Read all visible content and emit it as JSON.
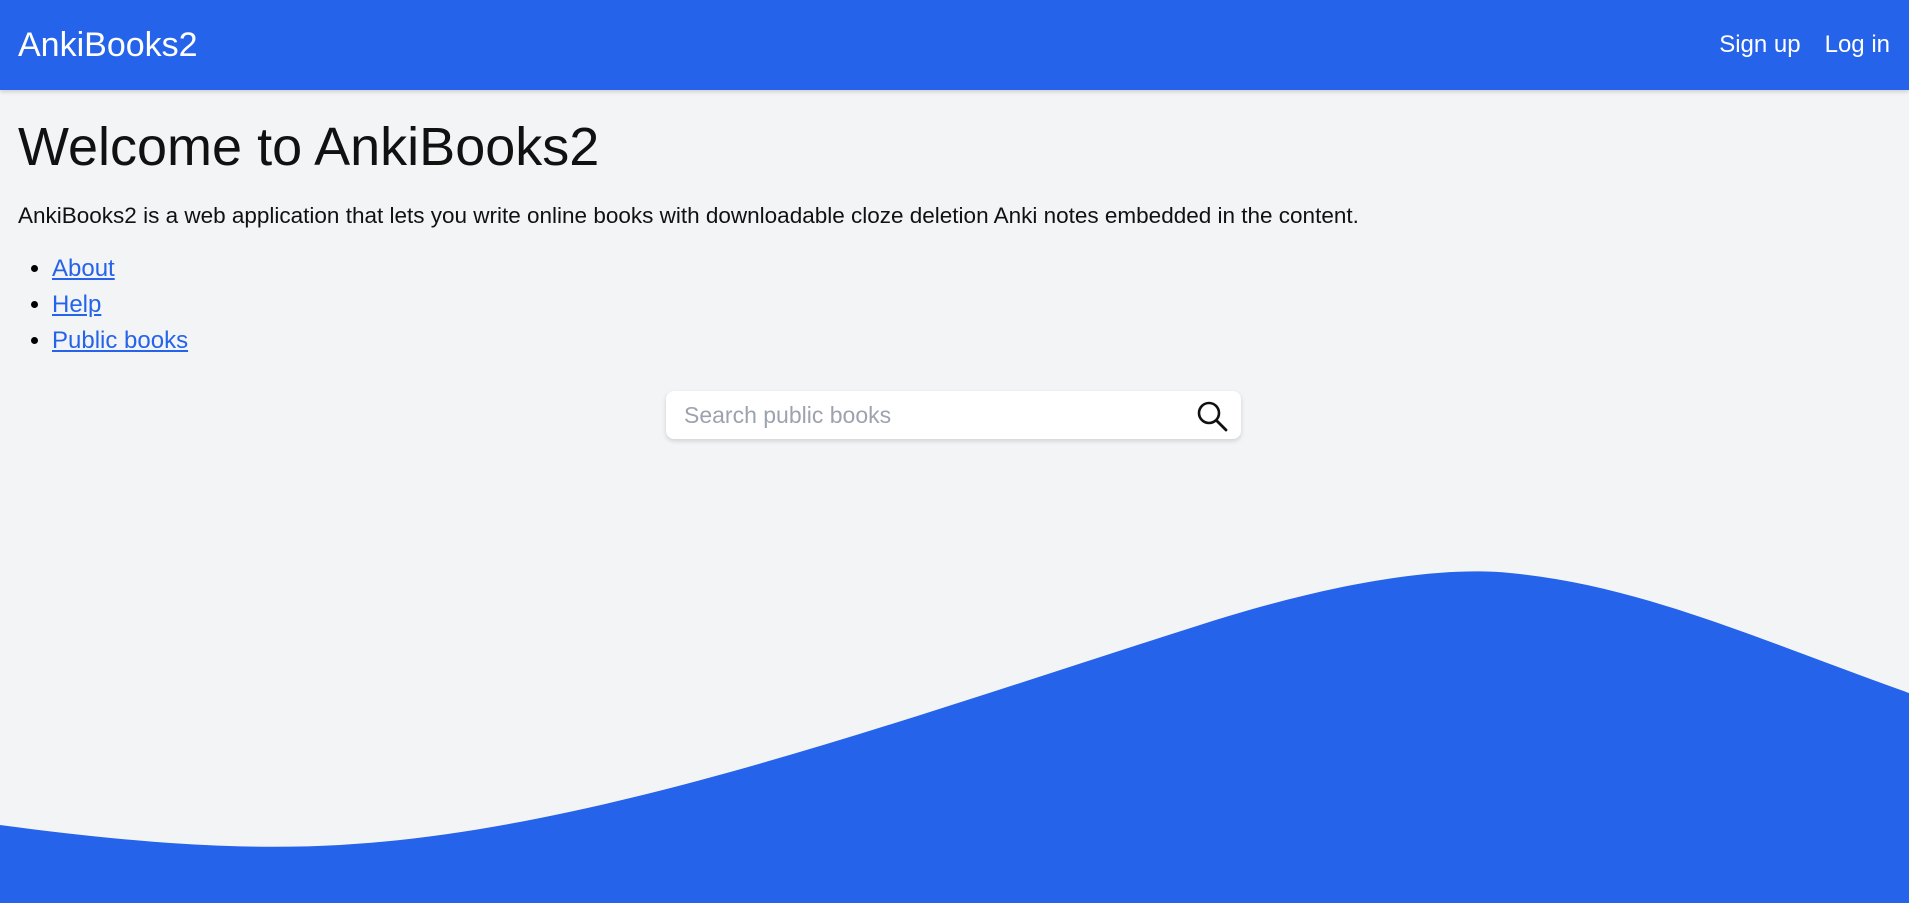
{
  "header": {
    "brand": "AnkiBooks2",
    "nav": [
      {
        "label": "Sign up"
      },
      {
        "label": "Log in"
      }
    ]
  },
  "main": {
    "title": "Welcome to AnkiBooks2",
    "intro": "AnkiBooks2 is a web application that lets you write online books with downloadable cloze deletion Anki notes embedded in the content.",
    "links": [
      {
        "label": "About"
      },
      {
        "label": "Help"
      },
      {
        "label": "Public books"
      }
    ]
  },
  "search": {
    "placeholder": "Search public books",
    "value": "",
    "icon": "search-icon"
  },
  "colors": {
    "accent": "#2563eb",
    "background": "#f3f4f6",
    "text": "#111111",
    "placeholder": "#9ca3af"
  }
}
